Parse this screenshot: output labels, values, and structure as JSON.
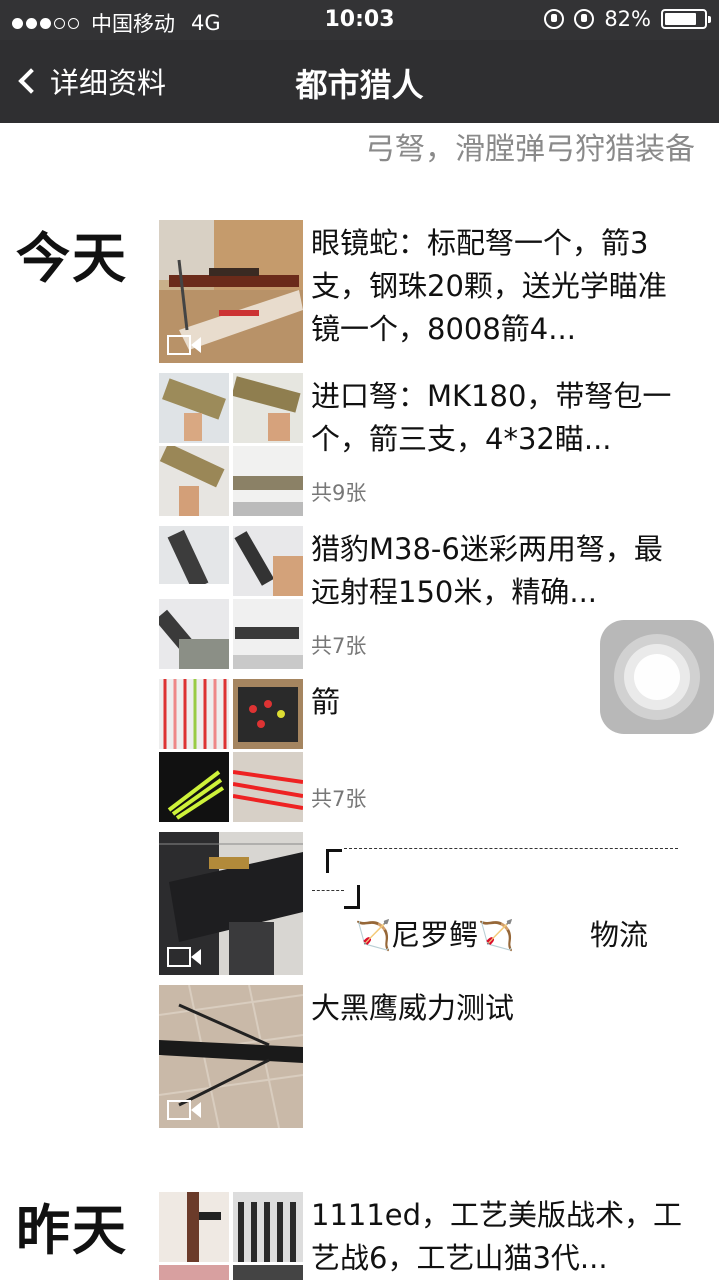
{
  "status": {
    "carrier": "中国移动",
    "network": "4G",
    "time": "10:03",
    "battery_text": "82%",
    "battery_level": 0.82
  },
  "nav": {
    "back_label": "详细资料",
    "title": "都市猎人"
  },
  "profile": {
    "signature": "弓弩，滑膛弹弓狩猎装备"
  },
  "days": {
    "today": "今天",
    "yesterday": "昨天"
  },
  "posts": [
    {
      "text": "眼镜蛇：标配弩一个，箭3支，钢珠20颗，送光学瞄准镜一个，8008箭4...",
      "type": "video"
    },
    {
      "text": "进口弩：MK180，带弩包一个，箭三支，4*32瞄...",
      "count": "共9张",
      "type": "album"
    },
    {
      "text": "猎豹M38-6迷彩两用弩，最远射程150米，精确...",
      "count": "共7张",
      "type": "album"
    },
    {
      "text": "箭",
      "count": "共7张",
      "type": "album"
    },
    {
      "text_name": "🏹尼罗鳄🏹",
      "text_tail": "物流",
      "type": "video"
    },
    {
      "text": "大黑鹰威力测试",
      "type": "video"
    },
    {
      "text": "1111ed，工艺美版战术，工艺战6，工艺山猫3代...",
      "type": "album"
    }
  ],
  "colors": {
    "status_bg": "#333335",
    "nav_bg": "#2f2f31",
    "signature": "#8a8a8a",
    "count": "#777777"
  }
}
